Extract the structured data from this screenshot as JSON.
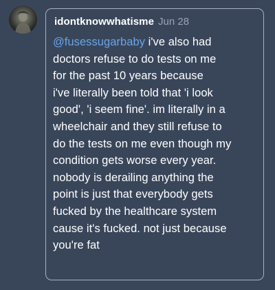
{
  "theme": {
    "background": "#39465a",
    "border": "#a9b0bc",
    "text": "#ffffff",
    "muted": "#9aa3b1",
    "mention": "#6aa4e8"
  },
  "reply": {
    "avatar_icon": "avatar-image",
    "username": "idontknowwhatisme",
    "date": "Jun 28",
    "mention": "@fusessugarbaby",
    "first_line_rest": " i've also had",
    "lines": [
      "doctors refuse to do tests on me",
      "for the past 10 years because",
      "i've literally been told that 'i look",
      "good', 'i seem fine'. im literally in a",
      "wheelchair and they still refuse to",
      "do the tests on me even though my",
      "condition gets worse every year.",
      "nobody is derailing anything the",
      "point is just that everybody gets",
      "fucked by the healthcare system",
      "cause it's fucked. not just because",
      "you're fat"
    ]
  }
}
